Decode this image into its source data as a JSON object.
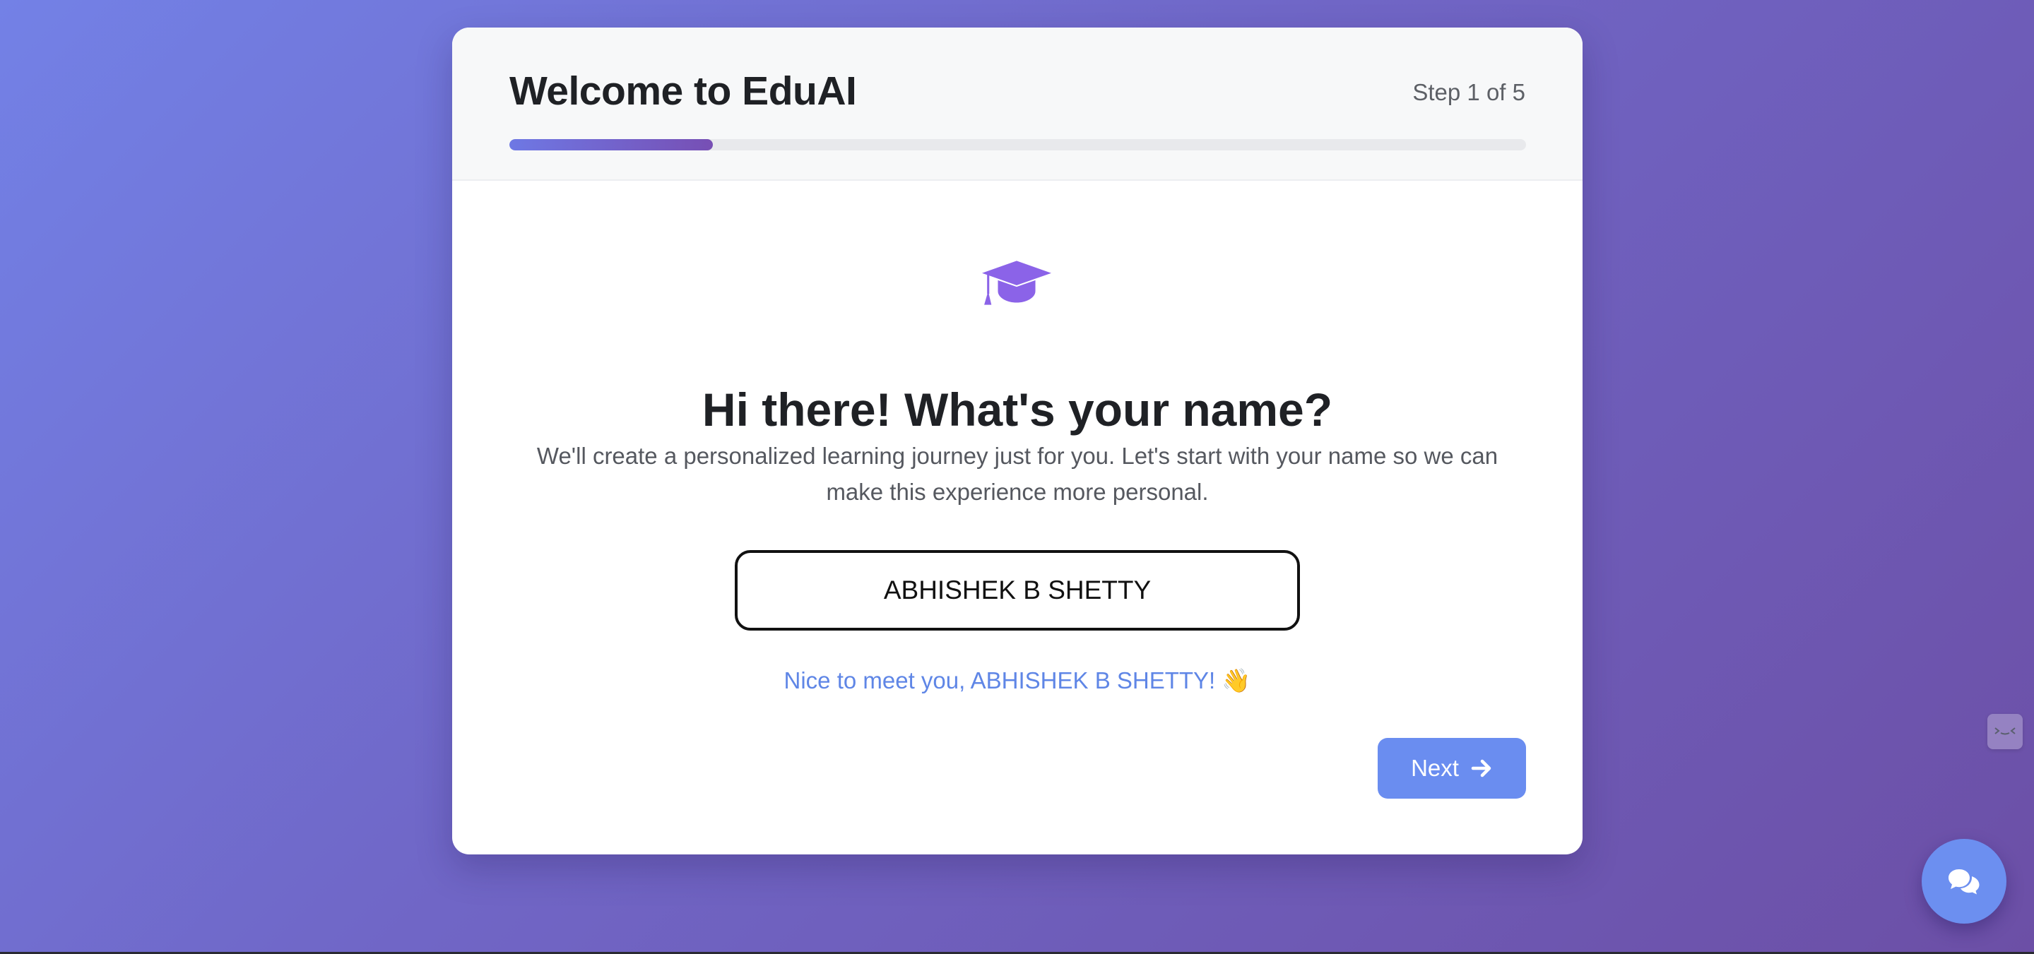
{
  "header": {
    "title": "Welcome to EduAI",
    "step_text": "Step 1 of 5",
    "progress_fraction": 0.2
  },
  "main": {
    "icon": "graduation-cap-icon",
    "question": "Hi there! What's your name?",
    "subtitle": "We'll create a personalized learning journey just for you. Let's start with your name so we can make this experience more personal.",
    "name_input_value": "ABHISHEK B SHETTY",
    "greeting": "Nice to meet you, ABHISHEK B SHETTY! 👋"
  },
  "footer": {
    "next_label": "Next",
    "next_icon": "arrow-right-icon"
  },
  "floating": {
    "widget_icon": "dev-tools-icon",
    "chat_icon": "chat-bubbles-icon"
  },
  "colors": {
    "accent": "#6a8df0",
    "progress_start": "#6e78e4",
    "progress_end": "#774fb4",
    "cap": "#8b63e8",
    "greeting": "#5f86e6"
  }
}
